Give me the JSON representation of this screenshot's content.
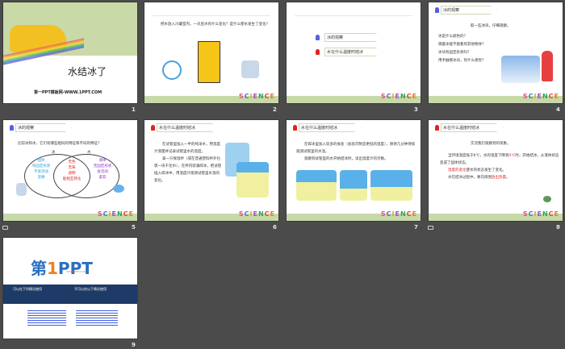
{
  "slides": [
    {
      "number": "1",
      "title": "水结冰了",
      "footer": "第一PPT模板网-WWW.1PPT.COM"
    },
    {
      "number": "2",
      "text": "把水放入冷藏室内，一天后水有什么变化？是什么使水发生了变化？",
      "logo": "SCIENCE"
    },
    {
      "number": "3",
      "items": [
        "冰的观察",
        "水在什么温度时结冰"
      ],
      "logo": "SCIENCE"
    },
    {
      "number": "4",
      "header": "冰的观察",
      "intro": "取一些冰块，仔细观察。",
      "bullets": [
        "冰是什么颜色的？",
        "隔着冰能不能看到其他物体？",
        "冰块有固定形状吗？",
        "用手触摸冰块，有什么感觉？"
      ],
      "logo": "SCIENCE"
    },
    {
      "number": "5",
      "header": "冰的观察",
      "question": "比较冰和水，它们有哪些相同的特征和不同的特征？",
      "ice_label": "冰",
      "water_label": "水",
      "ice_only": [
        "固体",
        "有固定形状",
        "不会流动",
        "坚硬"
      ],
      "common": [
        "无色",
        "无味",
        "透明",
        "能相互转化"
      ],
      "water_only": [
        "液体",
        "无固定形状",
        "会流动",
        "柔软"
      ],
      "logo": "SCIENCE"
    },
    {
      "number": "6",
      "header": "水在什么温度时结冰",
      "paragraphs": [
        "在试管里加入一半的纯净水，用温度计测量并记录试管里水的温度。",
        "拿一只保温杯（或在普通塑料杯外包裹一块干毛巾），在杯内装满碎冰，把试管插入碎冰中，用温度计观测试管里水温的变化。"
      ],
      "logo": "SCIENCE"
    },
    {
      "number": "7",
      "header": "水在什么温度时结冰",
      "paragraphs": [
        "在碎冰里加入较多的食盐（加盐可制造更低的温度），保持几分钟持续观测试管里的水温。",
        "观察到试管里的水开始结冰时，读出温度计的示数。"
      ],
      "logo": "SCIENCE"
    },
    {
      "number": "8",
      "header": "水在什么温度时结冰",
      "intro": "交流我们观察到的现象。",
      "line1_a": "当环境温度低于0℃，水的温度下降到",
      "line1_red": "0℃",
      "line1_b": "时，开始结冰，从液体状态变成了固体状态。",
      "line2_red": "温度的变化",
      "line2_b": "使水的状态发生了变化。",
      "line3_a": "水在结冰过程中，要向周围",
      "line3_red": "放出热量",
      "line3_b": "。",
      "logo": "SCIENCE"
    },
    {
      "number": "9",
      "brand_a": "第",
      "brand_b": "1",
      "brand_c": "PPT",
      "sub": "WWW.1PPT.COM",
      "can": "可以在下列情况使用",
      "cannot": "不可以在以下情况使用"
    }
  ],
  "colors": {
    "background": "#4b4b4b",
    "green": "#c7d9a8",
    "red": "#e02020",
    "navy": "#1e3a66"
  }
}
